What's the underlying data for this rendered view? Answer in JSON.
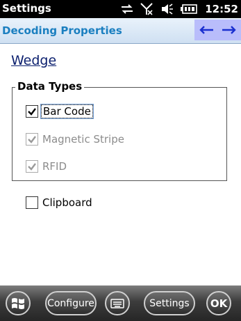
{
  "status": {
    "app_title": "Settings",
    "time": "12:52",
    "icons": [
      "sync-icon",
      "no-signal-icon",
      "volume-icon",
      "battery-icon"
    ]
  },
  "header": {
    "title": "Decoding Properties",
    "nav": [
      "left-arrow-icon",
      "right-arrow-icon"
    ],
    "accent": "#1b7fc0"
  },
  "content": {
    "section_link": "Wedge",
    "group_title": "Data Types",
    "options": [
      {
        "label": "Bar Code",
        "checked": true,
        "enabled": true
      },
      {
        "label": "Magnetic Stripe",
        "checked": true,
        "enabled": false
      },
      {
        "label": "RFID",
        "checked": true,
        "enabled": false
      }
    ],
    "clipboard": {
      "label": "Clipboard",
      "checked": false,
      "enabled": true
    }
  },
  "softkeys": {
    "start_icon": "windows-start-icon",
    "configure": "Configure",
    "keyboard_icon": "keyboard-icon",
    "settings": "Settings",
    "ok": "OK"
  }
}
